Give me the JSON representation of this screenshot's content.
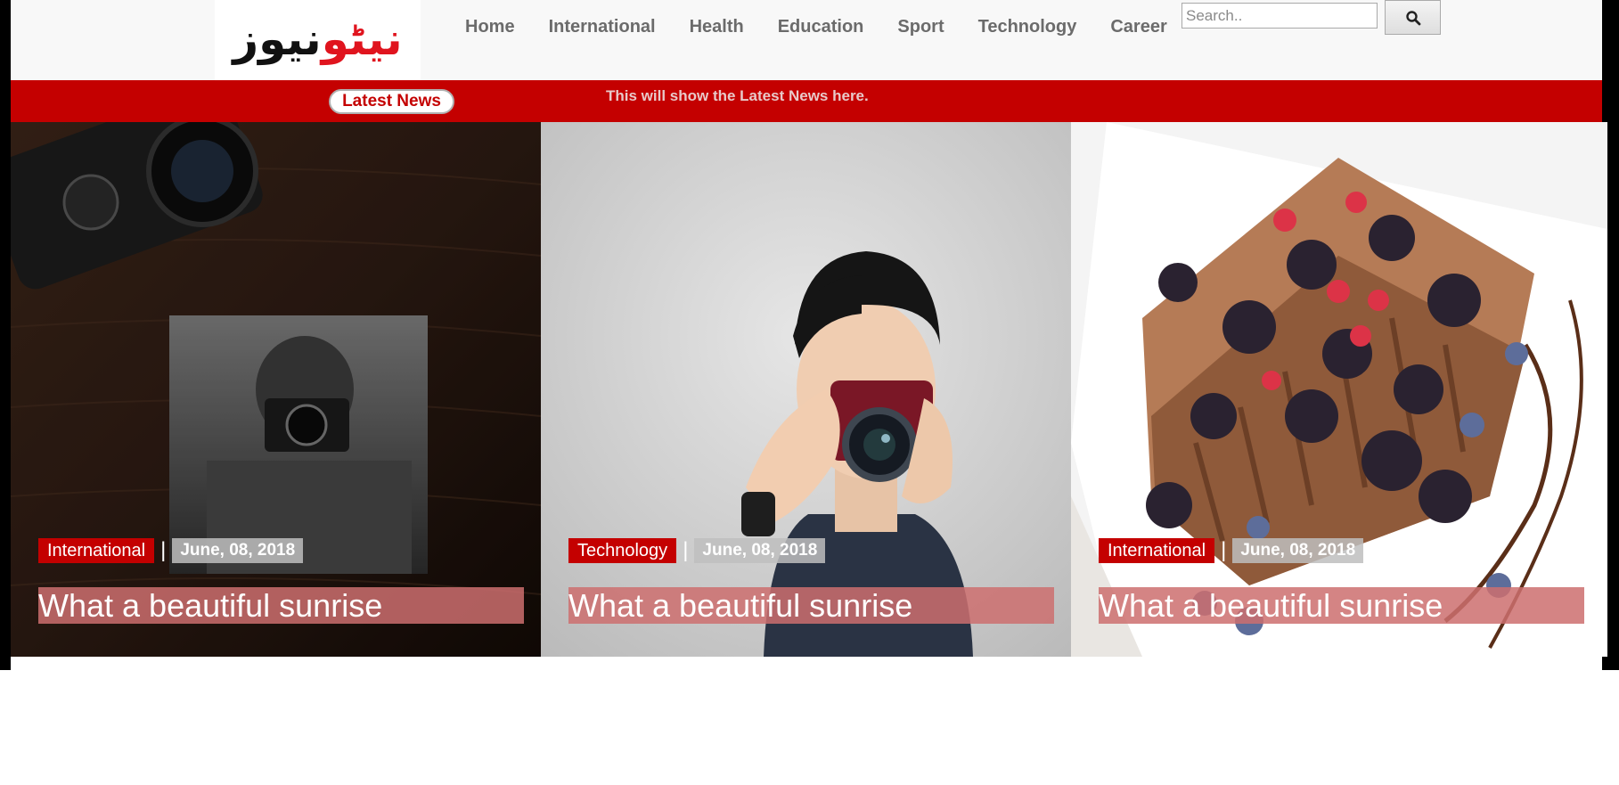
{
  "logo": {
    "part_red": "نیٹو",
    "part_black": "نیوز"
  },
  "nav": [
    "Home",
    "International",
    "Health",
    "Education",
    "Sport",
    "Technology",
    "Career"
  ],
  "search": {
    "placeholder": "Search..",
    "button_icon": "search-icon"
  },
  "ticker": {
    "badge": "Latest News",
    "text": "This will show the Latest News here."
  },
  "cards": [
    {
      "category": "International",
      "separator": "|",
      "date": "June, 08, 2018",
      "title": "What a beautiful sunrise",
      "image": "photo-camera-desk"
    },
    {
      "category": "Technology",
      "separator": "|",
      "date": "June, 08, 2018",
      "title": "What a beautiful sunrise",
      "image": "photo-man-with-camera"
    },
    {
      "category": "International",
      "separator": "|",
      "date": "June, 08, 2018",
      "title": "What a beautiful sunrise",
      "image": "photo-berry-dessert"
    }
  ],
  "colors": {
    "brand_red": "#c40000",
    "nav_text": "#6b6b6b",
    "header_bg": "#f8f8f8",
    "title_overlay": "#cd6e6e"
  }
}
